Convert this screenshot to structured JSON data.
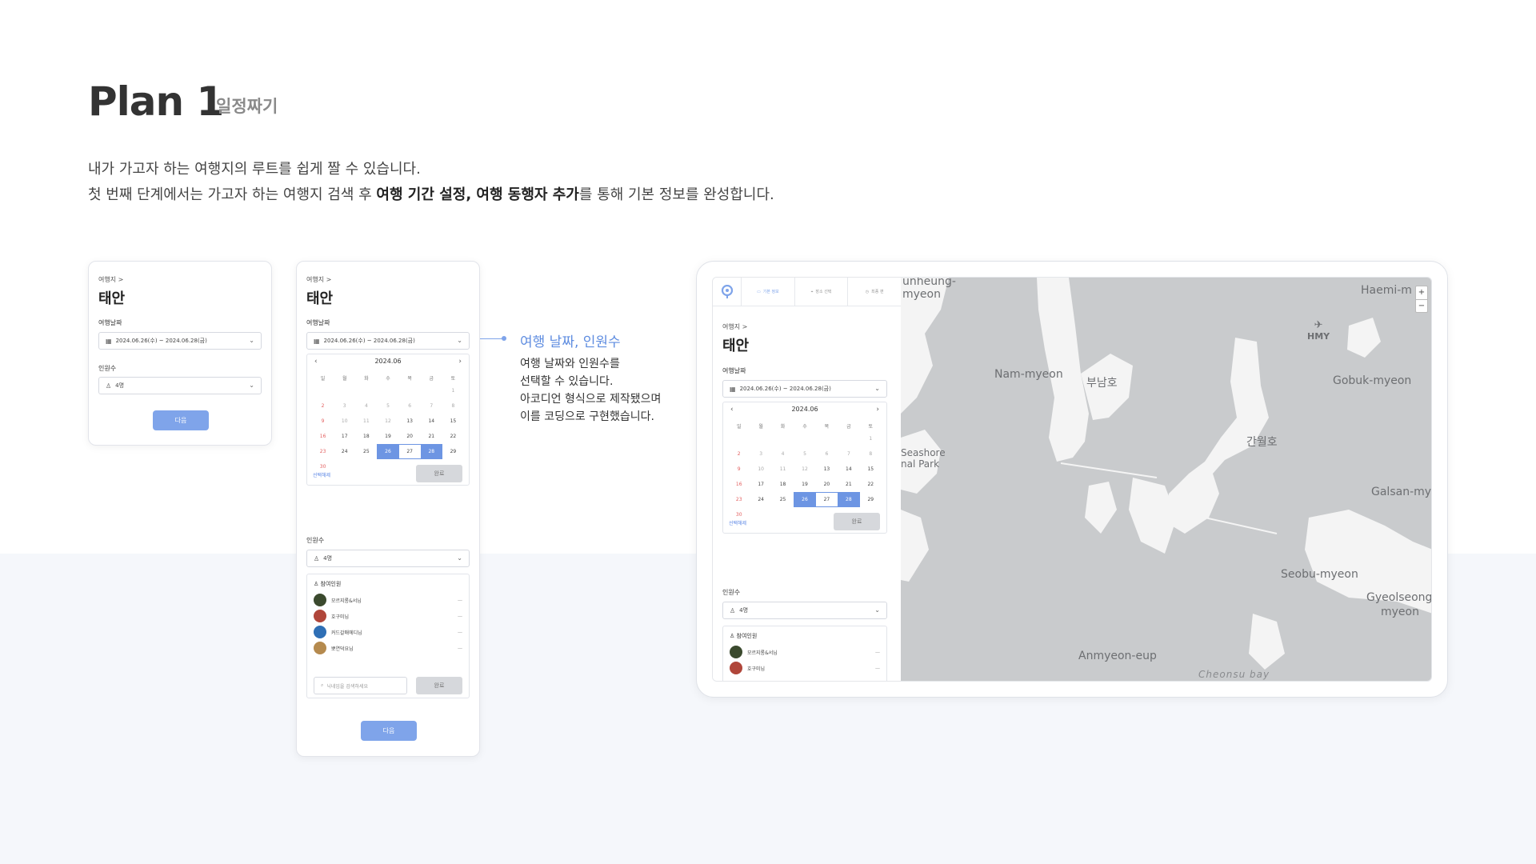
{
  "header": {
    "title": "Plan 1",
    "subtitle": "일정짜기",
    "desc_line1": "내가 가고자 하는 여행지의 루트를 쉽게 짤 수 있습니다.",
    "desc_line2_pre": "첫 번째 단계에서는 가고자 하는 여행지 검색 후 ",
    "desc_line2_bold": "여행 기간 설정, 여행 동행자 추가",
    "desc_line2_post": "를 통해 기본 정보를 완성합니다."
  },
  "form": {
    "breadcrumb": "여행지  >",
    "destination": "태안",
    "date_label": "여행날짜",
    "date_value": "2024.06.26(수) ~ 2024.06.28(금)",
    "people_label": "인원수",
    "people_value": "4명",
    "next_button": "다음"
  },
  "calendar": {
    "month": "2024.06",
    "prev": "‹",
    "next": "›",
    "weekdays": [
      "일",
      "월",
      "화",
      "수",
      "목",
      "금",
      "토"
    ],
    "days": [
      "",
      "",
      "",
      "",
      "",
      "",
      "1",
      "2",
      "3",
      "4",
      "5",
      "6",
      "7",
      "8",
      "9",
      "10",
      "11",
      "12",
      "13",
      "14",
      "15",
      "16",
      "17",
      "18",
      "19",
      "20",
      "21",
      "22",
      "23",
      "24",
      "25",
      "26",
      "27",
      "28",
      "29",
      "30",
      "",
      "",
      "",
      "",
      "",
      ""
    ],
    "reset_link": "선택해제",
    "done_button": "완료"
  },
  "members": {
    "title": "참여인원",
    "list": [
      {
        "name": "모르지롱&서님",
        "color": "#3b4a2e"
      },
      {
        "name": "호구미님",
        "color": "#b0463a"
      },
      {
        "name": "커드갈매에디님",
        "color": "#2f6fb5"
      },
      {
        "name": "뽀연덕요님",
        "color": "#b58a4e"
      }
    ],
    "remove": "—",
    "search_placeholder": "닉네임을 검색하세요",
    "done_button": "완료"
  },
  "annotation": {
    "title": "여행 날짜, 인원수",
    "line1": "여행 날짜와 인원수를",
    "line2": "선택할 수 있습니다.",
    "line3": "아코디언 형식으로 제작됐으며",
    "line4": "이를 코딩으로 구현했습니다."
  },
  "tablet": {
    "tabs": [
      {
        "icon": "document-icon",
        "step": "STEP",
        "label": "기본 정보"
      },
      {
        "icon": "pin-icon",
        "step": "STEP",
        "label": "장소 선택"
      },
      {
        "icon": "clock-icon",
        "step": "STEP",
        "label": "최종 편"
      }
    ],
    "map_labels": {
      "unheung": "unheung-",
      "myeon": "myeon",
      "haemi": "Haemi-m",
      "hmy": "HMY",
      "nam": "Nam-myeon",
      "bunam": "부남호",
      "gobuk": "Gobuk-myeon",
      "seashore": "Seashore",
      "nalpark": "nal Park",
      "ganwol": "간월호",
      "galsan": "Galsan-my",
      "seobu": "Seobu-myeon",
      "gyeol1": "Gyeolseong",
      "gyeol2": "myeon",
      "anmyeon": "Anmyeon-eup",
      "cheonsu": "Cheonsu bay"
    },
    "zoom_in": "+",
    "zoom_out": "−"
  },
  "colors": {
    "accent": "#7fa4ea",
    "selected": "#6d95e3",
    "sunday": "#e36060",
    "map_land": "#c9cbcd",
    "map_water": "#f4f4f4"
  }
}
